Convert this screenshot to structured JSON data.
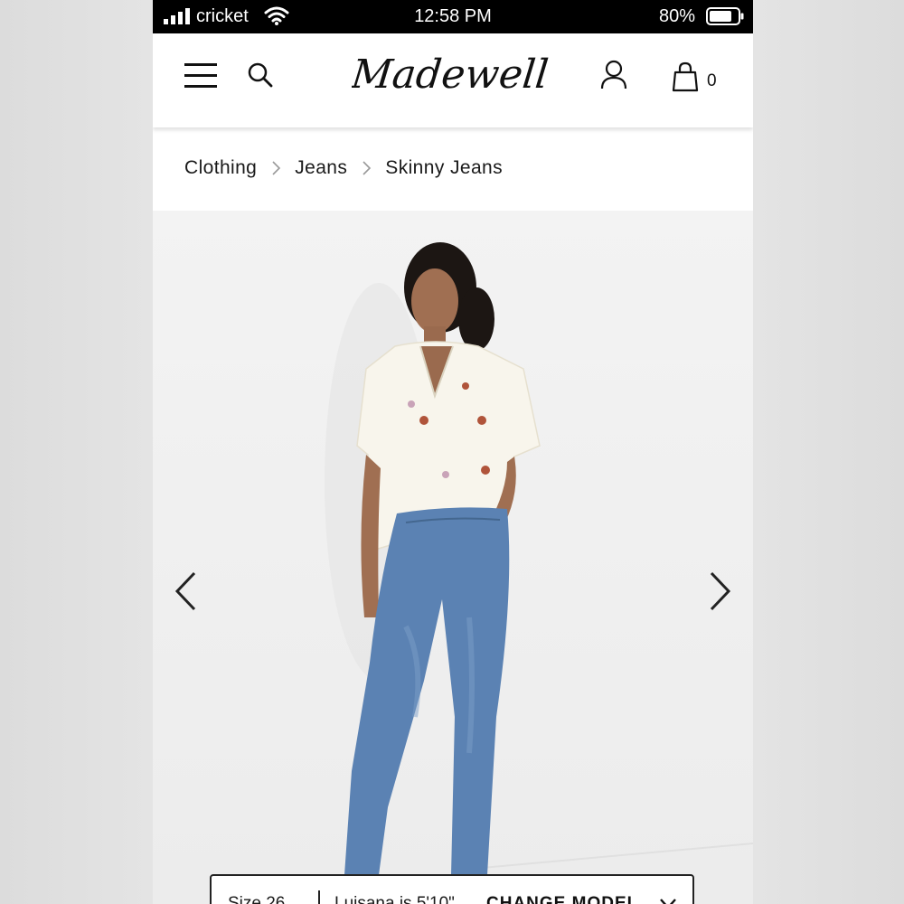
{
  "status_bar": {
    "carrier": "cricket",
    "time": "12:58 PM",
    "battery_percent": "80%",
    "battery_level": 0.8,
    "icons": [
      "signal-icon",
      "wifi-icon",
      "battery-icon"
    ]
  },
  "header": {
    "logo_text": "Madewell",
    "bag_count": "0",
    "icons": [
      "menu-icon",
      "search-icon",
      "account-icon",
      "shopping-bag-icon"
    ]
  },
  "breadcrumb": {
    "items": [
      "Clothing",
      "Jeans",
      "Skinny Jeans"
    ]
  },
  "carousel": {
    "icons": [
      "chevron-left-icon",
      "chevron-right-icon"
    ]
  },
  "model_info": {
    "size": "Size 26",
    "height": "Luisana is 5'10\"",
    "change_label": "CHANGE MODEL"
  },
  "colors": {
    "status_bar_bg": "#000000",
    "page_bg": "#ffffff",
    "text": "#1a1a1a",
    "denim": "#5b82b3",
    "shirt": "#f8f5ec"
  }
}
